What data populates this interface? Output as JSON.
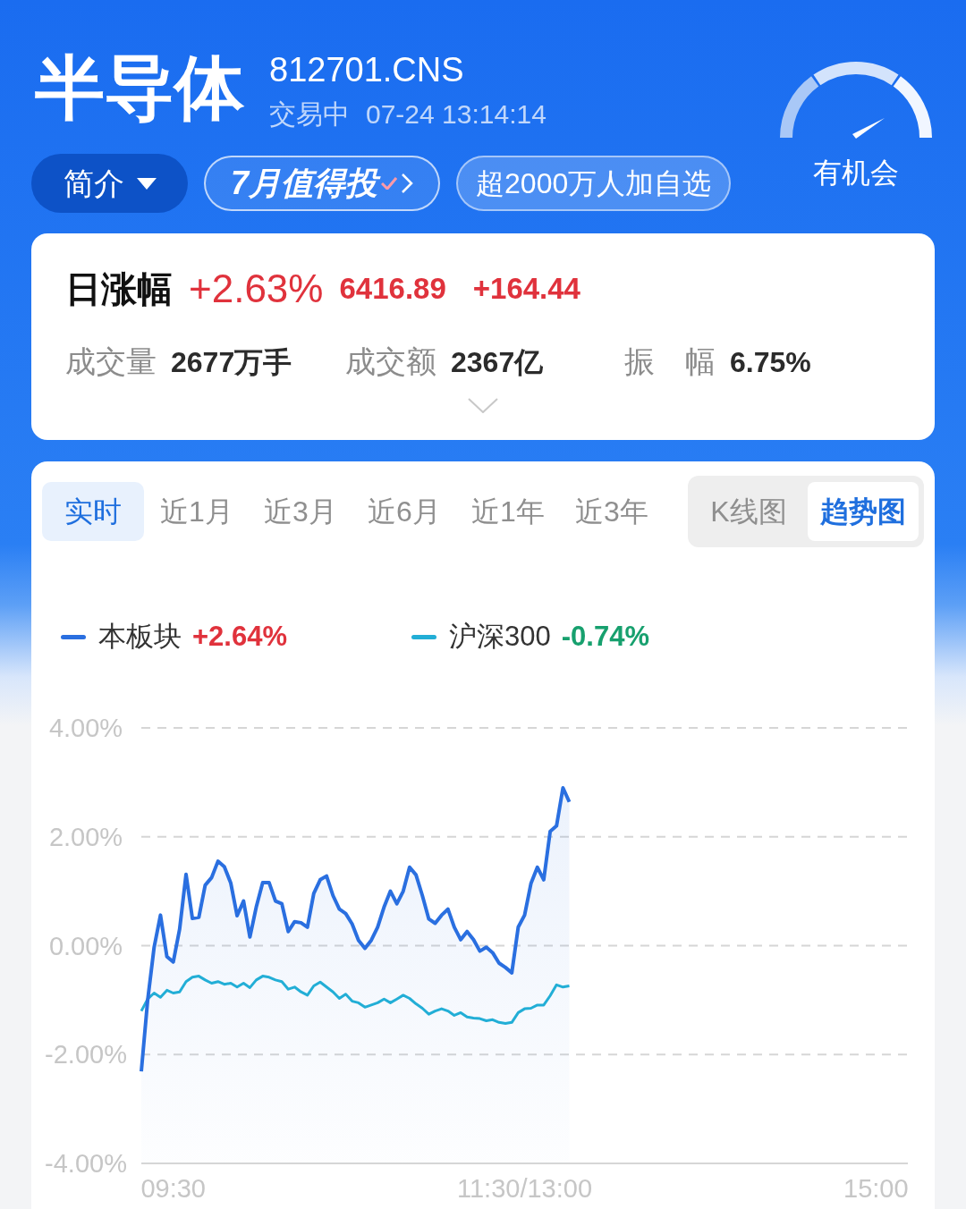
{
  "header": {
    "title": "半导体",
    "code": "812701.CNS",
    "status": "交易中",
    "time": "07-24 13:14:14"
  },
  "actions": [
    {
      "kind": "menu",
      "label": "简介"
    },
    {
      "kind": "promo",
      "label": "7月值得投"
    },
    {
      "kind": "tag",
      "label": "超2000万人加自选"
    }
  ],
  "gauge": {
    "label": "有机会"
  },
  "summary": {
    "title": "日涨幅",
    "change_pct": "+2.63%",
    "price": "6416.89",
    "change": "+164.44",
    "stats": [
      {
        "label": "成交量",
        "value": "2677万手"
      },
      {
        "label": "成交额",
        "value": "2367亿"
      },
      {
        "label": "振　幅",
        "value": "6.75%"
      }
    ]
  },
  "period_tabs": [
    {
      "label": "实时",
      "selected": true
    },
    {
      "label": "近1月",
      "selected": false
    },
    {
      "label": "近3月",
      "selected": false
    },
    {
      "label": "近6月",
      "selected": false
    },
    {
      "label": "近1年",
      "selected": false
    },
    {
      "label": "近3年",
      "selected": false
    }
  ],
  "chart_types": [
    {
      "label": "K线图",
      "selected": false
    },
    {
      "label": "趋势图",
      "selected": true
    }
  ],
  "legend": [
    {
      "change": "+2.64%",
      "color": "#e0323c"
    },
    {
      "change": "-0.74%",
      "color": "#17a06e"
    }
  ],
  "chart_data": {
    "type": "line",
    "grid": true,
    "categories": [
      null,
      null,
      null,
      null,
      null,
      "09:30",
      null,
      null,
      null,
      null,
      null,
      null,
      null,
      null,
      null,
      null,
      null,
      null,
      null,
      null,
      null,
      null,
      null,
      null,
      null,
      null,
      null,
      null,
      null,
      null,
      null,
      null,
      null,
      null,
      null,
      null,
      null,
      null,
      null,
      null,
      null,
      null,
      null,
      null,
      null,
      null,
      null,
      null,
      null,
      null,
      null,
      null,
      null,
      null,
      null,
      null,
      null,
      null,
      null,
      null,
      "11:30/13:00",
      null,
      null,
      null,
      null,
      null,
      null,
      null,
      null,
      null,
      null,
      null,
      null,
      null,
      null,
      null,
      null,
      null,
      null,
      null,
      null,
      null,
      null,
      null,
      null,
      null,
      null,
      null,
      null,
      null,
      null,
      null,
      null,
      null,
      null,
      null,
      null,
      null,
      null,
      null,
      null,
      null,
      null,
      null,
      null,
      null,
      null,
      null,
      null,
      null,
      null,
      null,
      null,
      null,
      null,
      "15:00",
      null,
      null,
      null,
      null,
      null
    ],
    "series": [
      {
        "name": "本板块",
        "color": "#2a6fe0",
        "values": [
          -2.31,
          -1.0,
          -0.03,
          0.56,
          -0.2,
          -0.3,
          0.3,
          1.31,
          0.5,
          0.52,
          1.11,
          1.25,
          1.55,
          1.45,
          1.15,
          0.55,
          0.82,
          0.16,
          0.71,
          1.16,
          1.16,
          0.82,
          0.77,
          0.26,
          0.44,
          0.42,
          0.34,
          0.96,
          1.21,
          1.28,
          0.92,
          0.67,
          0.59,
          0.4,
          0.1,
          -0.05,
          0.1,
          0.34,
          0.71,
          1.0,
          0.77,
          1.0,
          1.44,
          1.3,
          0.92,
          0.49,
          0.41,
          0.56,
          0.67,
          0.34,
          0.11,
          0.26,
          0.11,
          -0.1,
          -0.03,
          -0.13,
          -0.32,
          -0.4,
          -0.5,
          0.34,
          0.56,
          1.14,
          1.44,
          1.21,
          2.1,
          2.2,
          2.9,
          2.64,
          null,
          null,
          null,
          null,
          null,
          null,
          null,
          null,
          null,
          null,
          null,
          null,
          null,
          null,
          null,
          null,
          null,
          null,
          null,
          null,
          null,
          null,
          null,
          null,
          null,
          null,
          null,
          null,
          null,
          null,
          null,
          null,
          null,
          null,
          null,
          null,
          null,
          null,
          null,
          null,
          null,
          null,
          null,
          null,
          null,
          null,
          null,
          null,
          null,
          null,
          null,
          null,
          null
        ]
      },
      {
        "name": "沪深300",
        "color": "#22aed6",
        "values": [
          -1.2,
          -0.98,
          -0.87,
          -0.95,
          -0.82,
          -0.87,
          -0.85,
          -0.66,
          -0.58,
          -0.56,
          -0.63,
          -0.69,
          -0.66,
          -0.71,
          -0.69,
          -0.76,
          -0.69,
          -0.77,
          -0.63,
          -0.56,
          -0.58,
          -0.63,
          -0.66,
          -0.8,
          -0.76,
          -0.85,
          -0.91,
          -0.74,
          -0.67,
          -0.76,
          -0.85,
          -0.97,
          -0.89,
          -1.02,
          -1.05,
          -1.13,
          -1.09,
          -1.05,
          -0.98,
          -1.05,
          -0.98,
          -0.91,
          -0.97,
          -1.07,
          -1.15,
          -1.26,
          -1.2,
          -1.16,
          -1.2,
          -1.28,
          -1.23,
          -1.31,
          -1.33,
          -1.34,
          -1.38,
          -1.36,
          -1.41,
          -1.43,
          -1.41,
          -1.23,
          -1.16,
          -1.15,
          -1.09,
          -1.09,
          -0.92,
          -0.72,
          -0.76,
          -0.74,
          null,
          null,
          null,
          null,
          null,
          null,
          null,
          null,
          null,
          null,
          null,
          null,
          null,
          null,
          null,
          null,
          null,
          null,
          null,
          null,
          null,
          null,
          null,
          null,
          null,
          null,
          null,
          null,
          null,
          null,
          null,
          null,
          null,
          null,
          null,
          null,
          null,
          null,
          null,
          null,
          null,
          null,
          null,
          null,
          null,
          null,
          null,
          null,
          null,
          null,
          null,
          null,
          null
        ]
      }
    ],
    "ylim": [
      -4,
      4
    ],
    "yticks": [
      {
        "value": 4,
        "label": "4.00%"
      },
      {
        "value": 2,
        "label": "2.00%"
      },
      {
        "value": 0,
        "label": "0.00%"
      },
      {
        "value": -2,
        "label": "-2.00%"
      },
      {
        "value": -4,
        "label": "-4.00%"
      }
    ]
  }
}
